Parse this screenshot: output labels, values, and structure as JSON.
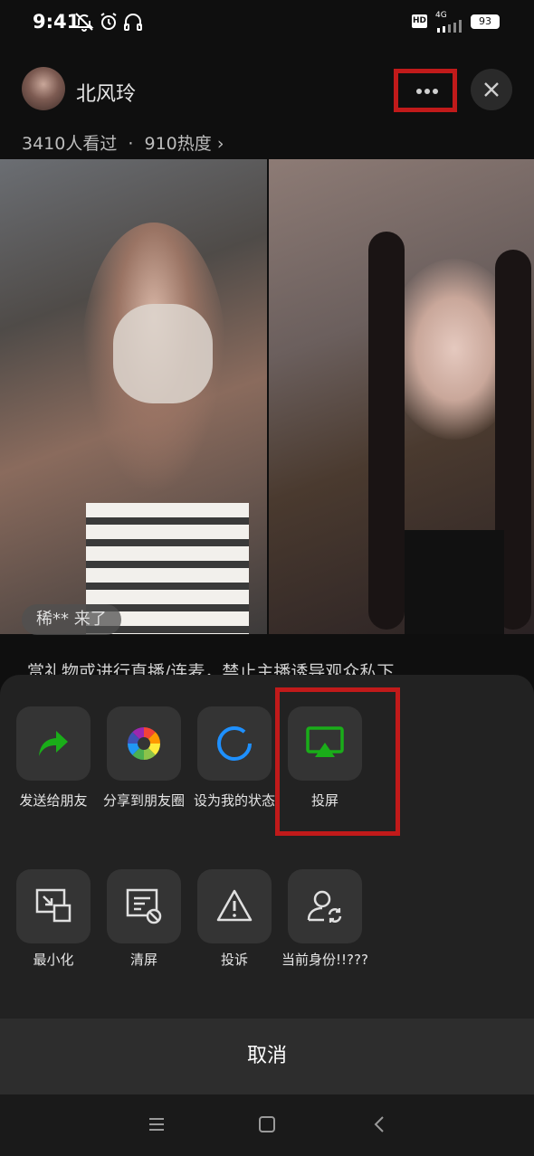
{
  "status_bar": {
    "time": "9:41",
    "hd": "HD",
    "network": "4G",
    "battery": "93"
  },
  "header": {
    "streamer_name": "北风玲",
    "viewers": "3410人看过",
    "separator": "·",
    "heat": "910热度",
    "heat_chevron": "›"
  },
  "feed": {
    "join_message": "稀** 来了",
    "notice_line": "赏礼物或进行直播/连麦，禁止主播诱导观众私下"
  },
  "share_sheet": {
    "row1": [
      {
        "label": "发送给朋友",
        "icon": "share-arrow-icon",
        "color": "#1aad19"
      },
      {
        "label": "分享到朋友圈",
        "icon": "moments-icon"
      },
      {
        "label": "设为我的状态",
        "icon": "status-ring-icon",
        "color": "#1e90ff"
      },
      {
        "label": "投屏",
        "icon": "cast-screen-icon",
        "color": "#1aad19"
      }
    ],
    "row2": [
      {
        "label": "最小化",
        "icon": "minimize-window-icon"
      },
      {
        "label": "清屏",
        "icon": "clear-screen-icon"
      },
      {
        "label": "投诉",
        "icon": "warning-icon"
      },
      {
        "label": "当前身份!!???",
        "icon": "switch-identity-icon"
      }
    ],
    "cancel": "取消"
  },
  "colors": {
    "highlight": "#c11a1a",
    "accent_green": "#1aad19",
    "sheet_bg": "#222222"
  }
}
